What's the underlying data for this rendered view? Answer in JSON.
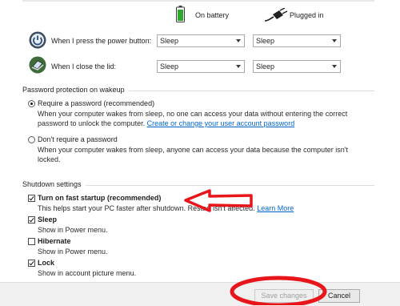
{
  "power_columns": {
    "on_battery": "On battery",
    "plugged_in": "Plugged in"
  },
  "power_rows": [
    {
      "label": "When I press the power button:",
      "battery_value": "Sleep",
      "plugged_value": "Sleep"
    },
    {
      "label": "When I close the lid:",
      "battery_value": "Sleep",
      "plugged_value": "Sleep"
    }
  ],
  "password_section": {
    "title": "Password protection on wakeup",
    "require": {
      "label": "Require a password (recommended)",
      "selected": true,
      "desc_line1": "When your computer wakes from sleep, no one can access your data without entering the correct",
      "desc_line2": "password to unlock the computer.",
      "link": "Create or change your user account password"
    },
    "dont_require": {
      "label": "Don't require a password",
      "selected": false,
      "desc_line1": "When your computer wakes from sleep, anyone can access your data because the computer isn't",
      "desc_line2": "locked."
    }
  },
  "shutdown_section": {
    "title": "Shutdown settings",
    "items": [
      {
        "label": "Turn on fast startup (recommended)",
        "checked": true,
        "desc": "This helps start your PC faster after shutdown. Restart isn't affected.",
        "link": "Learn More"
      },
      {
        "label": "Sleep",
        "checked": true,
        "desc": "Show in Power menu."
      },
      {
        "label": "Hibernate",
        "checked": false,
        "desc": "Show in Power menu."
      },
      {
        "label": "Lock",
        "checked": true,
        "desc": "Show in account picture menu."
      }
    ]
  },
  "footer": {
    "save_label": "Save changes",
    "save_enabled": false,
    "cancel_label": "Cancel"
  },
  "annotation_colors": {
    "arrow": "#e8151b",
    "ellipse": "#e8151b"
  }
}
